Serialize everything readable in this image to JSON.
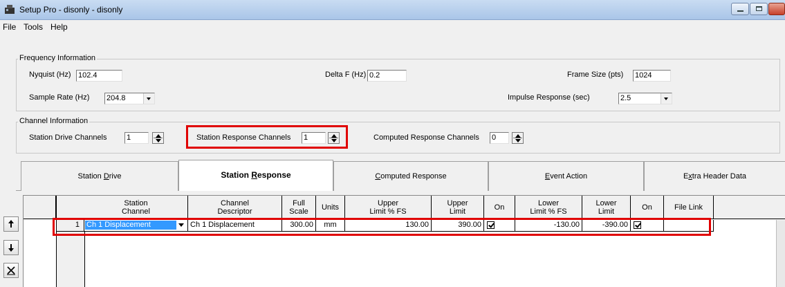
{
  "window": {
    "title": "Setup Pro - disonly - disonly"
  },
  "menu": [
    "File",
    "Tools",
    "Help"
  ],
  "frequency": {
    "group_title": "Frequency Information",
    "nyquist_label": "Nyquist (Hz)",
    "nyquist_value": "102.4",
    "delta_label": "Delta F (Hz)",
    "delta_value": "0.2",
    "frame_label": "Frame Size (pts)",
    "frame_value": "1024",
    "sample_label": "Sample Rate (Hz)",
    "sample_value": "204.8",
    "impulse_label": "Impulse Response (sec)",
    "impulse_value": "2.5"
  },
  "channel": {
    "group_title": "Channel Information",
    "drive_label": "Station Drive Channels",
    "drive_value": "1",
    "response_label": "Station Response Channels",
    "response_value": "1",
    "computed_label": "Computed Response Channels",
    "computed_value": "0"
  },
  "tabs": [
    {
      "pre": "Station ",
      "ul": "D",
      "post": "rive"
    },
    {
      "pre": "Station ",
      "ul": "R",
      "post": "esponse"
    },
    {
      "pre": "",
      "ul": "C",
      "post": "omputed Response"
    },
    {
      "pre": "",
      "ul": "E",
      "post": "vent Action"
    },
    {
      "pre": "E",
      "ul": "x",
      "post": "tra Header Data"
    }
  ],
  "grid": {
    "headers": [
      {
        "l1": "Station",
        "l2": "Channel"
      },
      {
        "l1": "Channel",
        "l2": "Descriptor"
      },
      {
        "l1": "Full",
        "l2": "Scale"
      },
      {
        "l1": "Units",
        "l2": ""
      },
      {
        "l1": "Upper",
        "l2": "Limit % FS"
      },
      {
        "l1": "Upper",
        "l2": "Limit"
      },
      {
        "l1": "On",
        "l2": ""
      },
      {
        "l1": "Lower",
        "l2": "Limit % FS"
      },
      {
        "l1": "Lower",
        "l2": "Limit"
      },
      {
        "l1": "On",
        "l2": ""
      },
      {
        "l1": "File Link",
        "l2": ""
      }
    ],
    "row": {
      "num": "1",
      "station_channel": "Ch 1 Displacement",
      "descriptor": "Ch 1 Displacement",
      "full_scale": "300.00",
      "units": "mm",
      "upper_pct": "130.00",
      "upper_limit": "390.00",
      "upper_on": true,
      "lower_pct": "-130.00",
      "lower_limit": "-390.00",
      "lower_on": true,
      "file_link": ""
    }
  },
  "colors": {
    "highlight": "#e00000",
    "selection": "#3399ff",
    "titlebar": "#b9d1ee"
  }
}
